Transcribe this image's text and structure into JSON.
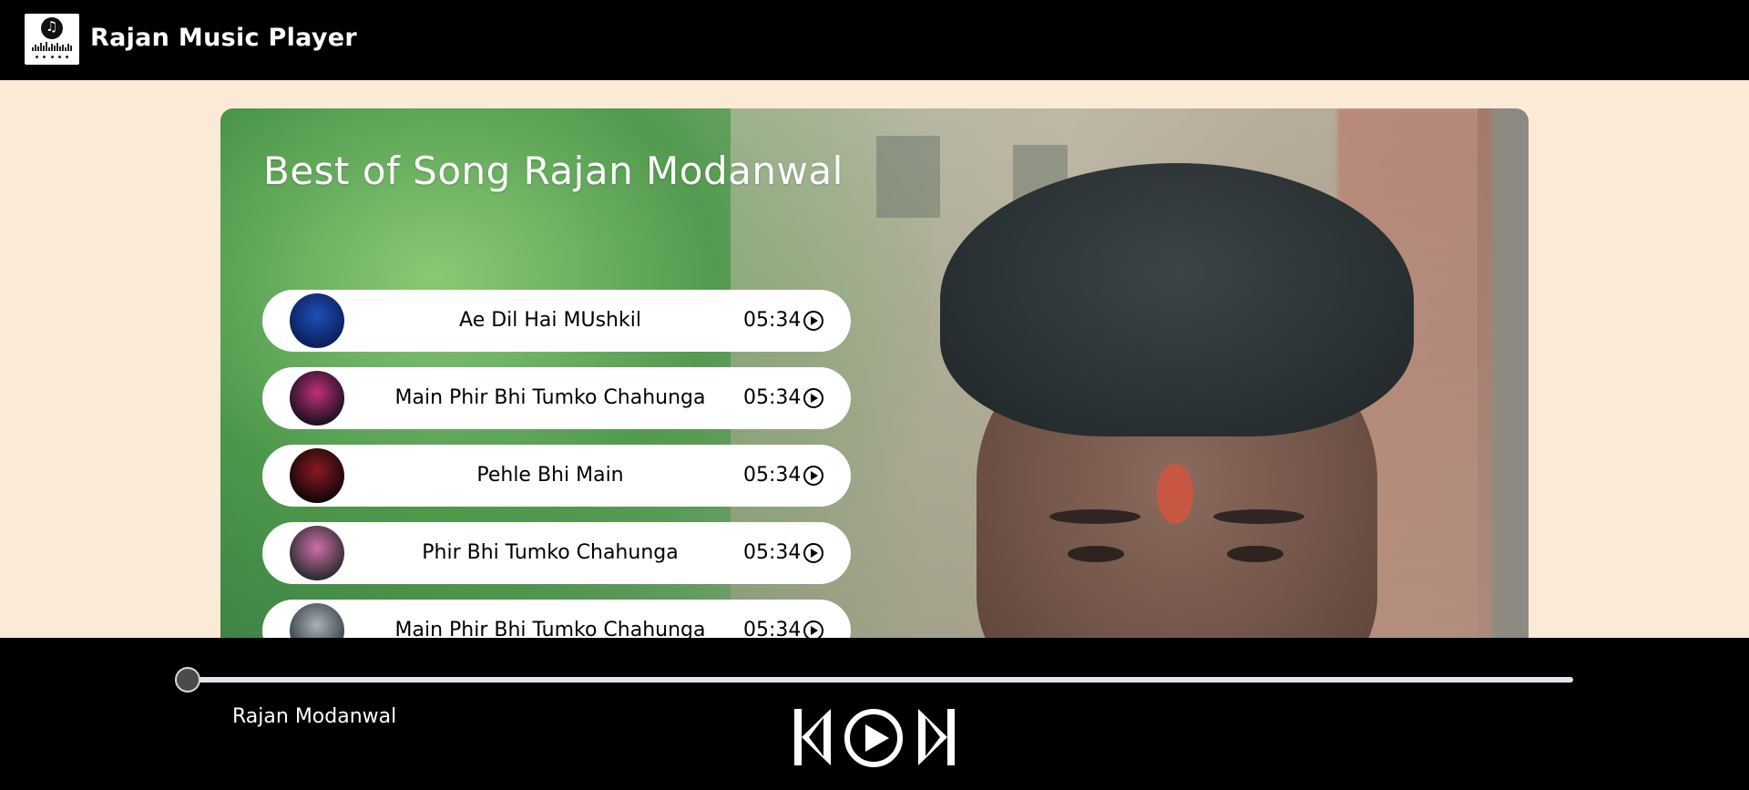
{
  "nav": {
    "brand": "Rajan Music Player",
    "logo_icon": "music-note-icon"
  },
  "hero": {
    "heading": "Best of Song Rajan Modanwal"
  },
  "songs": [
    {
      "title": "Ae Dil Hai MUshkil",
      "duration": "05:34",
      "thumb_colors": [
        "#0b1e5c",
        "#1f4fb8"
      ]
    },
    {
      "title": "Main Phir Bhi Tumko Chahunga",
      "duration": "05:34",
      "thumb_colors": [
        "#1a1020",
        "#c0307a"
      ]
    },
    {
      "title": "Pehle Bhi Main",
      "duration": "05:34",
      "thumb_colors": [
        "#120608",
        "#8a1a22"
      ]
    },
    {
      "title": "Phir Bhi Tumko Chahunga",
      "duration": "05:34",
      "thumb_colors": [
        "#2a2a30",
        "#d070a8"
      ]
    },
    {
      "title": "Main Phir Bhi Tumko Chahunga",
      "duration": "05:34",
      "thumb_colors": [
        "#3a4048",
        "#a8b0b8"
      ]
    }
  ],
  "player": {
    "artist": "Rajan Modanwal",
    "progress": 0
  }
}
